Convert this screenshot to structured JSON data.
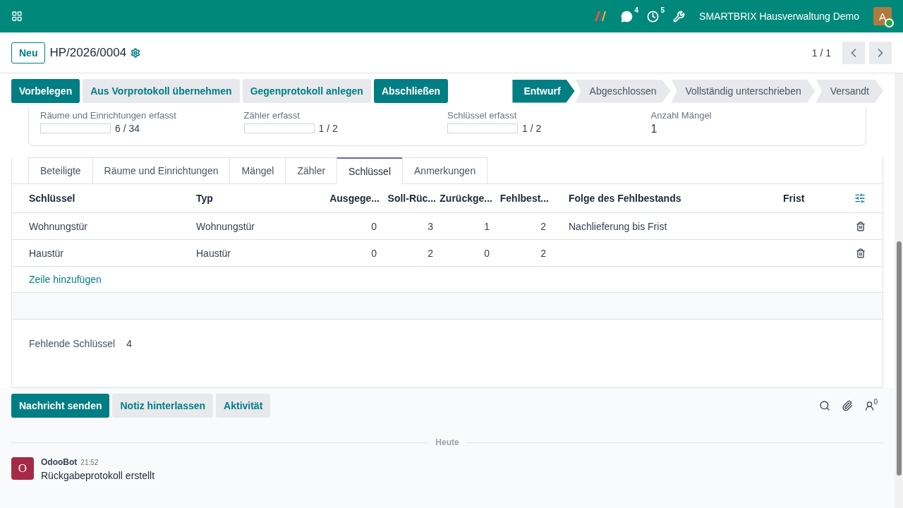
{
  "navbar": {
    "company": "SMARTBRIX Hausverwaltung Demo",
    "messages_count": "4",
    "activities_count": "5",
    "avatar_letter": "A"
  },
  "control_panel": {
    "new_button": "Neu",
    "record_name": "HP/2026/0004",
    "pager": "1 / 1"
  },
  "actions": [
    {
      "label": "Vorbelegen",
      "primary": true
    },
    {
      "label": "Aus Vorprotokoll übernehmen",
      "primary": false
    },
    {
      "label": "Gegenprotokoll anlegen",
      "primary": false
    },
    {
      "label": "Abschließen",
      "primary": true
    }
  ],
  "stages": [
    {
      "label": "Entwurf",
      "selected": true
    },
    {
      "label": "Abgeschlossen",
      "selected": false
    },
    {
      "label": "Vollständig unterschrieben",
      "selected": false
    },
    {
      "label": "Versandt",
      "selected": false
    }
  ],
  "summary": [
    {
      "kind": "progress",
      "label": "Räume und Einrichtungen erfasst",
      "level": 0,
      "reading": "6 / 34"
    },
    {
      "kind": "progress",
      "label": "Zähler erfasst",
      "level": 0,
      "reading": "1 / 2"
    },
    {
      "kind": "progress",
      "label": "Schlüssel erfasst",
      "level": 0,
      "reading": "1 / 2"
    },
    {
      "kind": "number",
      "label": "Anzahl Mängel",
      "value": "1"
    }
  ],
  "tabs": [
    {
      "label": "Beteiligte",
      "selected": false
    },
    {
      "label": "Räume und Einrichtungen",
      "selected": false
    },
    {
      "label": "Mängel",
      "selected": false
    },
    {
      "label": "Zähler",
      "selected": false
    },
    {
      "label": "Schlüssel",
      "selected": true
    },
    {
      "label": "Anmerkungen",
      "selected": false
    }
  ],
  "table": {
    "columns": [
      "Schlüssel",
      "Typ",
      "Ausgege...",
      "Soll-Rüc...",
      "Zurückge...",
      "Fehlbest...",
      "Folge des Fehlbestands",
      "Frist"
    ],
    "rows": [
      [
        "Wohnungstür",
        "Wohnungstür",
        "0",
        "3",
        "1",
        "2",
        "Nachlieferung bis Frist",
        ""
      ],
      [
        "Haustür",
        "Haustür",
        "0",
        "2",
        "0",
        "2",
        "",
        ""
      ]
    ],
    "add_line": "Zeile hinzufügen"
  },
  "missing_keys": {
    "label": "Fehlende Schlüssel",
    "value": "4"
  },
  "chatter": {
    "buttons": [
      {
        "label": "Nachricht senden",
        "primary": true
      },
      {
        "label": "Notiz hinterlassen",
        "primary": false
      },
      {
        "label": "Aktivität",
        "primary": false
      }
    ],
    "followers_count": "0",
    "date_separator": "Heute",
    "messages": [
      {
        "avatar": "O",
        "author": "OdooBot",
        "time": "21:52",
        "body": "Rückgabeprotokoll erstellt"
      }
    ]
  }
}
